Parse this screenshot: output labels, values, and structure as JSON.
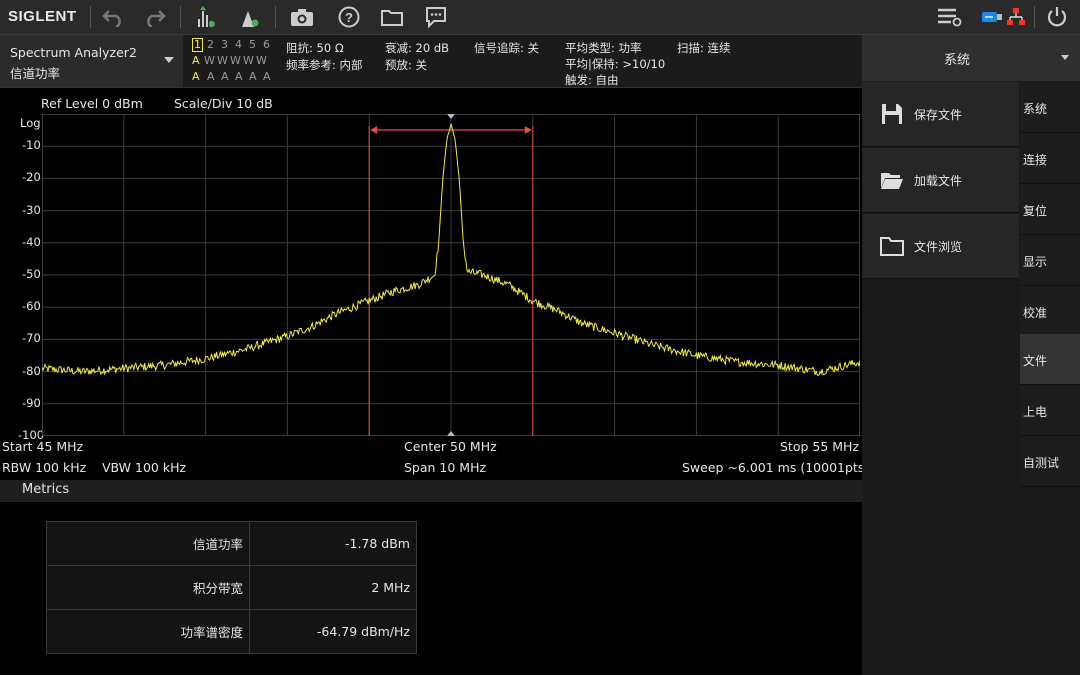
{
  "toolbar": {
    "logo": "SIGLENT",
    "icons": [
      "undo-icon",
      "redo-icon",
      "peak-marker-icon",
      "marker-icon",
      "camera-icon",
      "help-icon",
      "folder-icon",
      "chat-icon",
      "list-settings-icon",
      "usb-icon",
      "network-icon",
      "power-icon"
    ]
  },
  "header": {
    "mode_title": "Spectrum Analyzer2",
    "mode_subtitle": "信道功率",
    "traces": {
      "numbers": [
        "1",
        "2",
        "3",
        "4",
        "5",
        "6"
      ],
      "types": [
        "A",
        "W",
        "W",
        "W",
        "W",
        "W"
      ],
      "modes": [
        "A",
        "A",
        "A",
        "A",
        "A",
        "A"
      ]
    },
    "impedance": "阻抗: 50 Ω",
    "freq_ref": "频率参考: 内部",
    "attenuation": "衰减: 20 dB",
    "preamp": "预放: 关",
    "signal_track": "信号追踪: 关",
    "avg_type": "平均类型: 功率",
    "avg_hold": "平均|保持: >10/10",
    "trigger": "触发: 自由",
    "sweep_mode": "扫描: 连续"
  },
  "plot": {
    "ref_level": "Ref Level  0 dBm",
    "scale_div": "Scale/Div  10 dB",
    "log_label": "Log",
    "y_ticks": [
      "-10",
      "-20",
      "-30",
      "-40",
      "-50",
      "-60",
      "-70",
      "-80",
      "-90",
      "-100"
    ],
    "start": "Start  45 MHz",
    "center": "Center  50 MHz",
    "stop": "Stop  55 MHz",
    "rbw": "RBW  100 kHz",
    "vbw": "VBW  100 kHz",
    "span": "Span  10 MHz",
    "sweep": "Sweep  ~6.001 ms (10001pts)"
  },
  "chart_data": {
    "type": "line",
    "x_unit": "MHz",
    "y_unit": "dBm",
    "xlim": [
      45,
      55
    ],
    "ylim": [
      -100,
      0
    ],
    "grid": true,
    "trace_color": "#f2e84a",
    "channel_bounds": [
      49,
      51
    ],
    "x": [
      45,
      45.5,
      46,
      46.5,
      47,
      47.5,
      48,
      48.3,
      48.6,
      48.9,
      49,
      49.3,
      49.6,
      49.8,
      49.85,
      49.9,
      49.95,
      50,
      50.05,
      50.1,
      50.15,
      50.2,
      50.4,
      50.7,
      51,
      51.3,
      51.6,
      52,
      52.5,
      53,
      53.5,
      54,
      54.5,
      55
    ],
    "y": [
      -79,
      -80,
      -79,
      -78,
      -76,
      -73,
      -69,
      -66,
      -62,
      -59,
      -58,
      -55,
      -53,
      -50,
      -40,
      -20,
      -8,
      -3,
      -8,
      -20,
      -40,
      -49,
      -50,
      -53,
      -58,
      -61,
      -65,
      -68,
      -72,
      -75,
      -77,
      -78,
      -80,
      -77
    ]
  },
  "metrics": {
    "title": "Metrics",
    "rows": [
      {
        "name": "信道功率",
        "value": "-1.78 dBm"
      },
      {
        "name": "积分带宽",
        "value": "2 MHz"
      },
      {
        "name": "功率谱密度",
        "value": "-64.79 dBm/Hz"
      }
    ]
  },
  "right_panel": {
    "title": "系统",
    "buttons": [
      {
        "label": "保存文件",
        "icon": "save-icon"
      },
      {
        "label": "加载文件",
        "icon": "open-folder-icon"
      },
      {
        "label": "文件浏览",
        "icon": "folder-icon"
      }
    ],
    "tabs": [
      "系统",
      "连接",
      "复位",
      "显示",
      "校准",
      "文件",
      "上电",
      "自测试"
    ],
    "active_tab": "文件"
  }
}
